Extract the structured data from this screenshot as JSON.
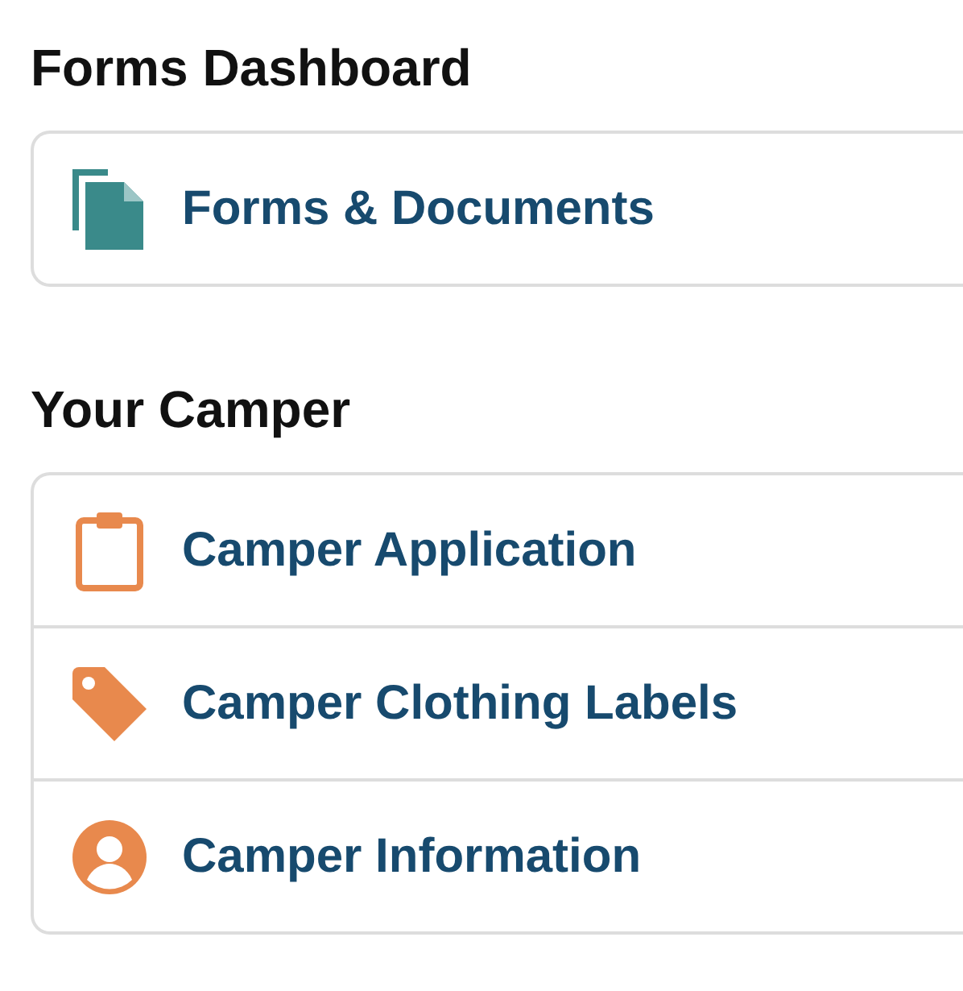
{
  "sections": [
    {
      "heading": "Forms Dashboard",
      "items": [
        {
          "label": "Forms & Documents",
          "kind": "documents"
        }
      ]
    },
    {
      "heading": "Your Camper",
      "items": [
        {
          "label": "Camper Application",
          "kind": "clipboard"
        },
        {
          "label": "Camper Clothing Labels",
          "kind": "tag"
        },
        {
          "label": "Camper Information",
          "kind": "person"
        }
      ]
    }
  ]
}
